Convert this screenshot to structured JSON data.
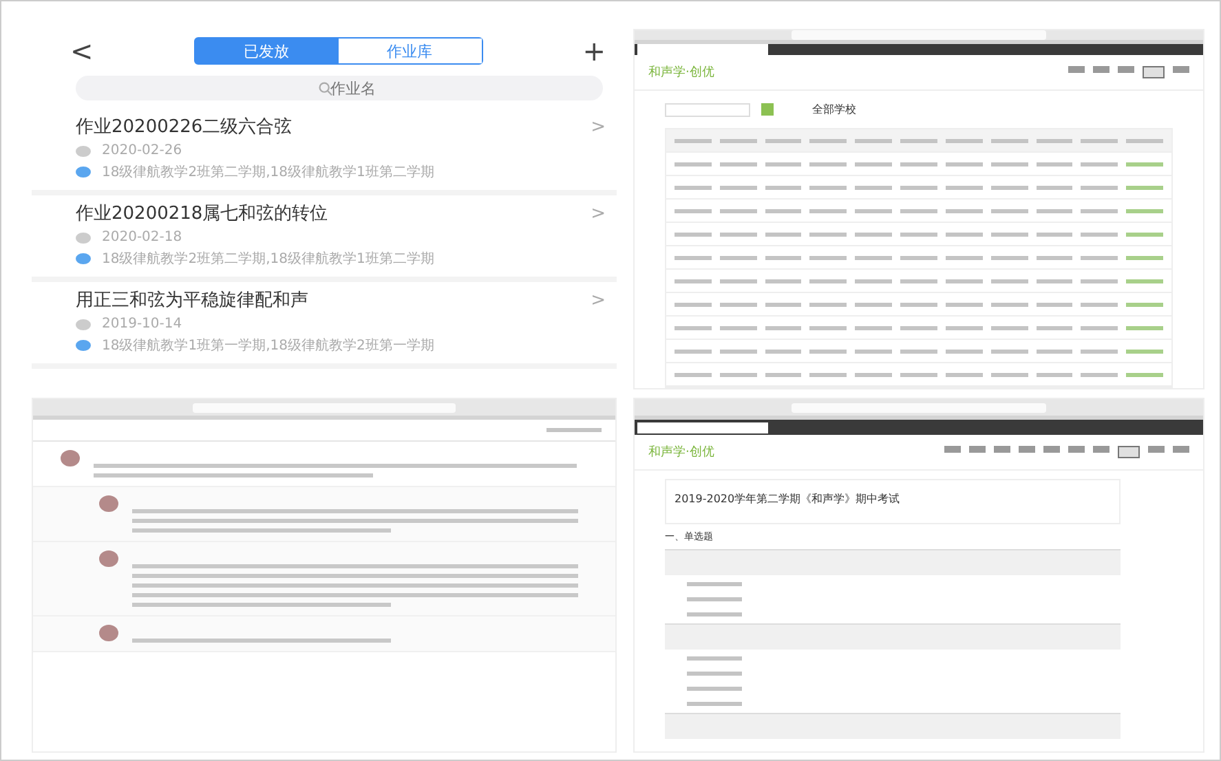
{
  "mobile_app": {
    "back": "<",
    "tabs": [
      {
        "label": "已发放",
        "selected": true
      },
      {
        "label": "作业库",
        "selected": false
      }
    ],
    "add": "+",
    "search": {
      "placeholder": "作业名"
    },
    "assignments": [
      {
        "title": "作业20200226二级六合弦",
        "date": "2020-02-26",
        "classes": "18级律航教学2班第二学期,18级律航教学1班第二学期",
        "arrow": ">"
      },
      {
        "title": "作业20200218属七和弦的转位",
        "date": "2020-02-18",
        "classes": "18级律航教学2班第二学期,18级律航教学1班第二学期",
        "arrow": ">"
      },
      {
        "title": "用正三和弦为平稳旋律配和声",
        "date": "2019-10-14",
        "classes": "18级律航教学1班第一学期,18级律航教学2班第一学期",
        "arrow": ">"
      }
    ]
  },
  "grades_page": {
    "logo": "和声学·创优",
    "nav": [
      {
        "selected": false
      },
      {
        "selected": false
      },
      {
        "selected": false
      },
      {
        "selected": true
      },
      {
        "selected": false
      }
    ],
    "school_filter": "全部学校"
  },
  "exam_page": {
    "logo": "和声学·创优",
    "nav": [
      {
        "selected": false
      },
      {
        "selected": false
      },
      {
        "selected": false
      },
      {
        "selected": false
      },
      {
        "selected": false
      },
      {
        "selected": false
      },
      {
        "selected": false
      },
      {
        "selected": true
      },
      {
        "selected": false
      },
      {
        "selected": false
      }
    ],
    "exam_title": "2019-2020学年第二学期《和声学》期中考试",
    "section": "一、单选题"
  }
}
